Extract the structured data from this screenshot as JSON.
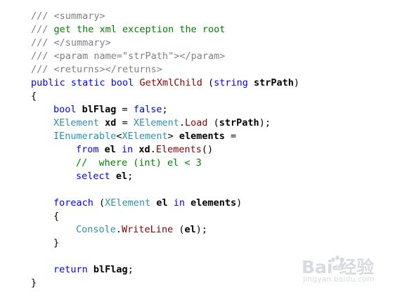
{
  "code": {
    "lines": [
      [
        {
          "t": "/// <summary>",
          "c": "cm"
        }
      ],
      [
        {
          "t": "/// ",
          "c": "cm"
        },
        {
          "t": "get the xml exception the root",
          "c": "cmg"
        }
      ],
      [
        {
          "t": "/// </summary>",
          "c": "cm"
        }
      ],
      [
        {
          "t": "/// <param name=\"strPath\"></param>",
          "c": "cm"
        }
      ],
      [
        {
          "t": "/// <returns></returns>",
          "c": "cm"
        }
      ],
      [
        {
          "t": "public static bool ",
          "c": "kw"
        },
        {
          "t": "GetXmlChild",
          "c": "mt"
        },
        {
          "t": " (",
          "c": "pn"
        },
        {
          "t": "string ",
          "c": "kw"
        },
        {
          "t": "strPath",
          "c": "id"
        },
        {
          "t": ")",
          "c": "pn"
        }
      ],
      [
        {
          "t": "{",
          "c": "pn"
        }
      ],
      [
        {
          "t": "bool ",
          "c": "kw"
        },
        {
          "t": "blFlag",
          "c": "id"
        },
        {
          "t": " = ",
          "c": "pn"
        },
        {
          "t": "false",
          "c": "kw"
        },
        {
          "t": ";",
          "c": "pn"
        }
      ],
      [
        {
          "t": "XElement",
          "c": "ty"
        },
        {
          "t": " ",
          "c": "pn"
        },
        {
          "t": "xd",
          "c": "id"
        },
        {
          "t": " = ",
          "c": "pn"
        },
        {
          "t": "XElement",
          "c": "ty"
        },
        {
          "t": ".",
          "c": "pn"
        },
        {
          "t": "Load",
          "c": "mt"
        },
        {
          "t": " (",
          "c": "pn"
        },
        {
          "t": "strPath",
          "c": "id"
        },
        {
          "t": ");",
          "c": "pn"
        }
      ],
      [
        {
          "t": "IEnumerable",
          "c": "ty"
        },
        {
          "t": "<",
          "c": "pn"
        },
        {
          "t": "XElement",
          "c": "ty"
        },
        {
          "t": "> ",
          "c": "pn"
        },
        {
          "t": "elements",
          "c": "id"
        },
        {
          "t": " =",
          "c": "pn"
        }
      ],
      [
        {
          "t": "from ",
          "c": "kw"
        },
        {
          "t": "el",
          "c": "id"
        },
        {
          "t": " in ",
          "c": "kw"
        },
        {
          "t": "xd",
          "c": "id"
        },
        {
          "t": ".",
          "c": "pn"
        },
        {
          "t": "Elements",
          "c": "mt"
        },
        {
          "t": "()",
          "c": "pn"
        }
      ],
      [
        {
          "t": "//  where (int) el < 3",
          "c": "cmg"
        }
      ],
      [
        {
          "t": "select ",
          "c": "kw"
        },
        {
          "t": "el",
          "c": "id"
        },
        {
          "t": ";",
          "c": "pn"
        }
      ],
      [],
      [
        {
          "t": "foreach",
          "c": "kw"
        },
        {
          "t": " (",
          "c": "pn"
        },
        {
          "t": "XElement",
          "c": "ty"
        },
        {
          "t": " ",
          "c": "pn"
        },
        {
          "t": "el",
          "c": "id"
        },
        {
          "t": " in ",
          "c": "kw"
        },
        {
          "t": "elements",
          "c": "id"
        },
        {
          "t": ")",
          "c": "pn"
        }
      ],
      [
        {
          "t": "{",
          "c": "pn"
        }
      ],
      [
        {
          "t": "Console",
          "c": "ty"
        },
        {
          "t": ".",
          "c": "pn"
        },
        {
          "t": "WriteLine",
          "c": "mt"
        },
        {
          "t": " (",
          "c": "pn"
        },
        {
          "t": "el",
          "c": "id"
        },
        {
          "t": ");",
          "c": "pn"
        }
      ],
      [
        {
          "t": "}",
          "c": "pn"
        }
      ],
      [],
      [
        {
          "t": "return ",
          "c": "kw"
        },
        {
          "t": "blFlag",
          "c": "id"
        },
        {
          "t": ";",
          "c": "pn"
        }
      ],
      [
        {
          "t": "}",
          "c": "pn"
        }
      ]
    ]
  },
  "watermark": {
    "brand": "Bai  经验",
    "url": "jingyan.baidu.com"
  }
}
